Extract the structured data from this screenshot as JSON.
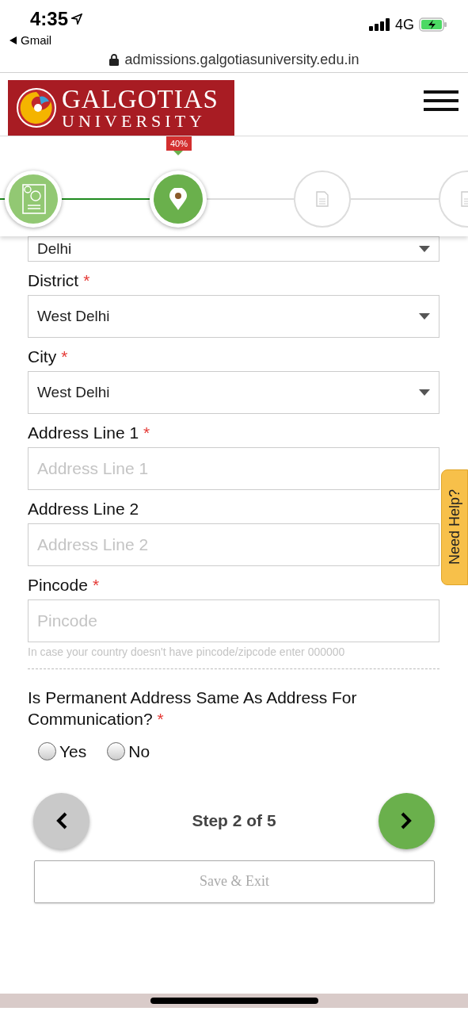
{
  "status_bar": {
    "time": "4:35",
    "back_app": "Gmail",
    "network": "4G"
  },
  "address_bar": {
    "url": "admissions.galgotiasuniversity.edu.in"
  },
  "header": {
    "logo_line1": "GALGOTIAS",
    "logo_line2": "UNIVERSITY"
  },
  "progress": {
    "label": "40%",
    "steps": [
      {
        "kind": "done"
      },
      {
        "kind": "current"
      },
      {
        "kind": "pending"
      },
      {
        "kind": "pending"
      }
    ]
  },
  "fields": [
    {
      "kind": "select",
      "value": "Delhi"
    },
    {
      "kind": "select",
      "label": "District",
      "required_mark": "*",
      "value": "West Delhi"
    },
    {
      "kind": "select",
      "label": "City",
      "required_mark": "*",
      "value": "West Delhi"
    },
    {
      "kind": "text",
      "label": "Address Line 1",
      "required_mark": "*",
      "placeholder": "Address Line 1"
    },
    {
      "kind": "text",
      "label": "Address Line 2",
      "placeholder": "Address Line 2"
    },
    {
      "kind": "text",
      "label": "Pincode",
      "required_mark": "*",
      "placeholder": "Pincode",
      "hint": "In case your country doesn't have pincode/zipcode enter 000000"
    }
  ],
  "question": {
    "text": "Is Permanent Address Same As Address For Communication?",
    "required_mark": "*",
    "options": [
      {
        "label": "Yes",
        "selected": false
      },
      {
        "label": "No",
        "selected": false
      }
    ]
  },
  "navigation": {
    "step_text": "Step 2 of 5",
    "save_button": "Save & Exit"
  },
  "help_tab": "Need Help?"
}
